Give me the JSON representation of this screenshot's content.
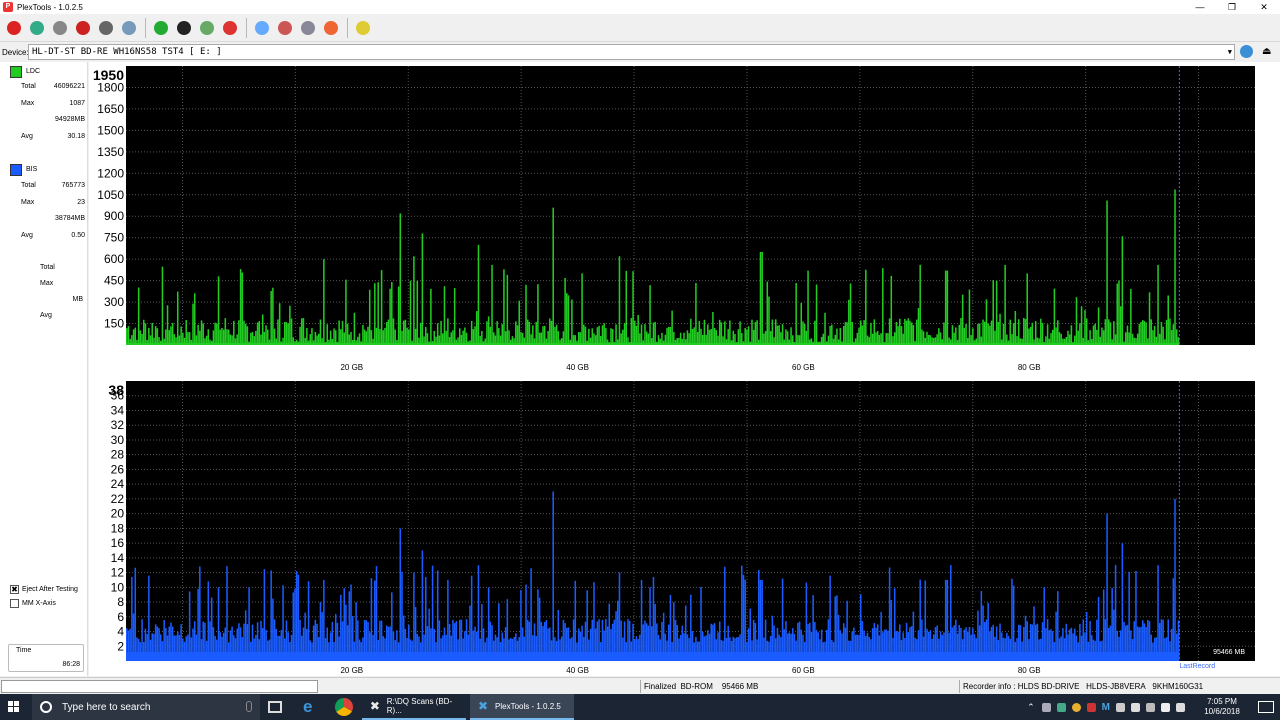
{
  "window": {
    "title": "PlexTools - 1.0.2.5",
    "min_icon": "minimize-icon",
    "max_icon": "restore-icon",
    "close_icon": "close-icon"
  },
  "toolbar": {
    "buttons": [
      {
        "icon": "power-icon",
        "color": "#d22"
      },
      {
        "icon": "wand-icon",
        "color": "#3a8"
      },
      {
        "icon": "drive-icon",
        "color": "#888"
      },
      {
        "icon": "disc-red-icon",
        "color": "#c22"
      },
      {
        "icon": "disc-gray-icon",
        "color": "#666"
      },
      {
        "icon": "drive-config-icon",
        "color": "#79b"
      },
      {
        "icon": "refresh-icon",
        "color": "#2a3"
      },
      {
        "icon": "globe-icon",
        "color": "#222"
      },
      {
        "icon": "eject-icon",
        "color": "#6a6"
      },
      {
        "icon": "stop-icon",
        "color": "#d33"
      },
      {
        "icon": "blank-disc-icon",
        "color": "#6af"
      },
      {
        "icon": "erase-icon",
        "color": "#c55"
      },
      {
        "icon": "settings-disc-icon",
        "color": "#889"
      },
      {
        "icon": "plugin-icon",
        "color": "#e63"
      },
      {
        "icon": "chart-icon",
        "color": "#dc3"
      }
    ]
  },
  "device": {
    "label": "Device:",
    "value": "HL-DT-ST BD-RE  WH16NS58  TST4 [ E: ]"
  },
  "left": {
    "ldc": {
      "label": "LDC",
      "color": "#22cc22",
      "total_k": "Total",
      "total_v": "46096221",
      "max_k": "Max",
      "max_v": "1087",
      "mb_v": "94928MB",
      "avg_k": "Avg",
      "avg_v": "30.18"
    },
    "bis": {
      "label": "BIS",
      "color": "#1a5cff",
      "total_k": "Total",
      "total_v": "765773",
      "max_k": "Max",
      "max_v": "23",
      "mb_v": "38784MB",
      "avg_k": "Avg",
      "avg_v": "0.50"
    },
    "third": {
      "total_k": "Total",
      "max_k": "Max",
      "mb_k": "MB",
      "avg_k": "Avg"
    },
    "eject_label": "Eject After Testing",
    "eject_checked": "✖",
    "mmx_label": "MM X-Axis",
    "time_label": "Time",
    "time_value": "86:28"
  },
  "chart_data": [
    {
      "type": "area",
      "name": "LDC",
      "color": "#22cc22",
      "y_top_label": "1950",
      "yticks": [
        150,
        300,
        450,
        600,
        750,
        900,
        1050,
        1200,
        1350,
        1500,
        1650,
        1800
      ],
      "ylim": [
        0,
        1950
      ],
      "xlim": [
        0,
        100
      ],
      "xticks": [
        "20 GB",
        "40 GB",
        "60 GB",
        "80 GB"
      ],
      "xtick_values": [
        20,
        40,
        60,
        80
      ],
      "data_end_x": 93.3,
      "peaks": [
        [
          24.2,
          920
        ],
        [
          26.2,
          780
        ],
        [
          37.8,
          960
        ],
        [
          25.4,
          620
        ],
        [
          17.4,
          600
        ],
        [
          8.1,
          480
        ],
        [
          31.1,
          700
        ],
        [
          32.4,
          560
        ],
        [
          43.6,
          620
        ],
        [
          56.2,
          650
        ],
        [
          70.3,
          560
        ],
        [
          72.6,
          520
        ],
        [
          86.8,
          1010
        ],
        [
          88.2,
          760
        ],
        [
          92.9,
          1087
        ],
        [
          91.3,
          560
        ],
        [
          60.3,
          520
        ],
        [
          79.8,
          500
        ]
      ],
      "baseline": 200
    },
    {
      "type": "area",
      "name": "BIS",
      "color": "#1a5cff",
      "y_top_label": "38",
      "yticks": [
        2,
        4,
        6,
        8,
        10,
        12,
        14,
        16,
        18,
        20,
        22,
        24,
        26,
        28,
        30,
        32,
        34,
        36
      ],
      "ylim": [
        0,
        38
      ],
      "xlim": [
        0,
        100
      ],
      "xticks": [
        "20 GB",
        "40 GB",
        "60 GB",
        "80 GB"
      ],
      "xtick_values": [
        20,
        40,
        60,
        80
      ],
      "data_end_x": 93.3,
      "peaks": [
        [
          24.2,
          18
        ],
        [
          26.2,
          15
        ],
        [
          37.8,
          23
        ],
        [
          31.1,
          13
        ],
        [
          25.4,
          12
        ],
        [
          8.1,
          10
        ],
        [
          17.4,
          11
        ],
        [
          43.6,
          12
        ],
        [
          56.2,
          11
        ],
        [
          86.8,
          20
        ],
        [
          88.2,
          16
        ],
        [
          92.9,
          22
        ],
        [
          91.3,
          13
        ],
        [
          72.6,
          11
        ]
      ],
      "baseline": 4,
      "end_label": "95466 MB",
      "last_record_label": "LastRecord"
    }
  ],
  "status": {
    "finalized": "Finalized",
    "media": "BD-ROM",
    "size": "95466 MB",
    "recorder": "Recorder info : HLDS BD-DRIVE",
    "model": "HLDS-JB8VERA",
    "serial": "9KHM160G31"
  },
  "taskbar": {
    "search_placeholder": "Type here to search",
    "task1": "R:\\DQ Scans (BD-R)...",
    "task2": "PlexTools - 1.0.2.5",
    "time": "7:05 PM",
    "date": "10/6/2018",
    "tray_m": "M"
  }
}
